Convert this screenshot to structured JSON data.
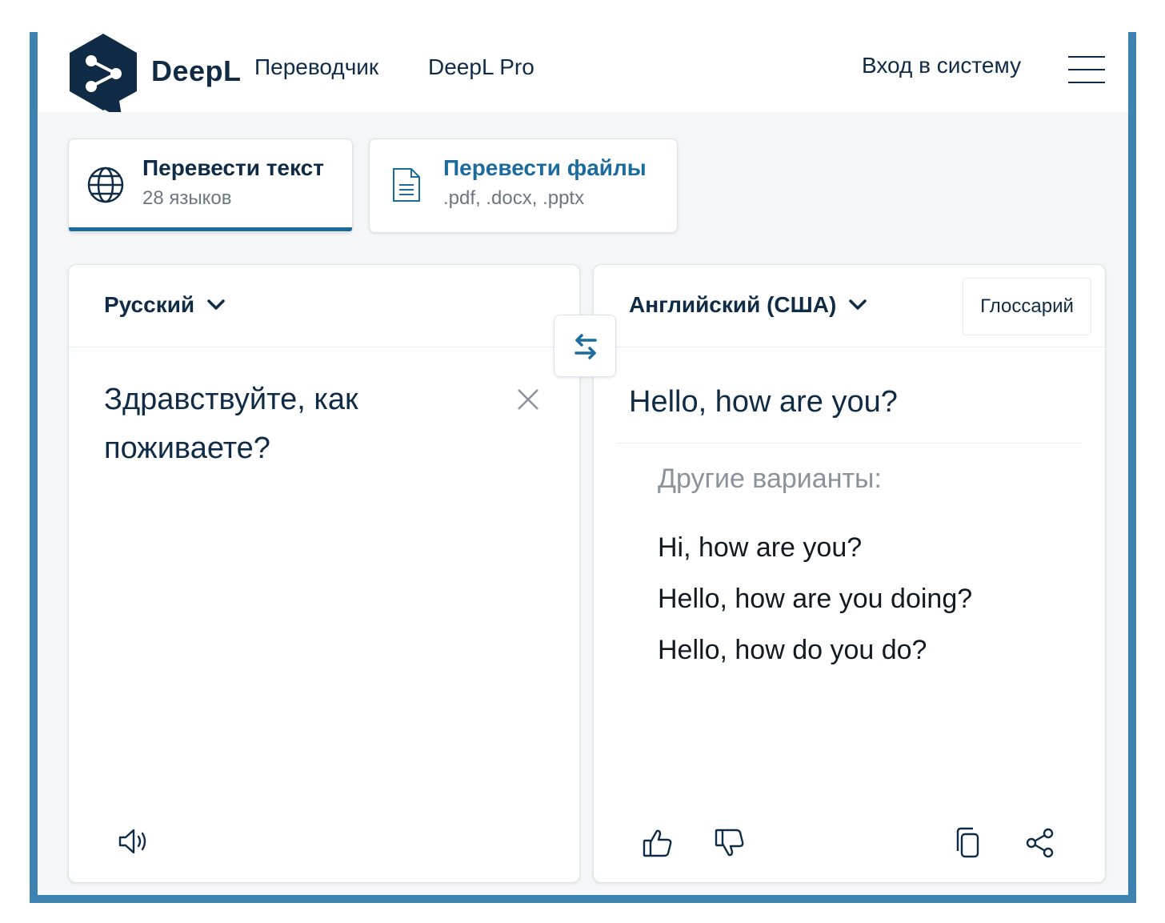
{
  "header": {
    "logo_word": "DeepL",
    "logo_sub": "Переводчик",
    "nav_pro": "DeepL Pro",
    "login": "Вход в систему"
  },
  "modes": {
    "text": {
      "title": "Перевести текст",
      "subtitle": "28 языков"
    },
    "files": {
      "title": "Перевести файлы",
      "subtitle": ".pdf, .docx, .pptx"
    }
  },
  "source": {
    "language": "Русский",
    "text": "Здравствуйте, как поживаете?"
  },
  "target": {
    "language": "Английский (США)",
    "glossary": "Глоссарий",
    "text": "Hello, how are you?",
    "alternatives_title": "Другие варианты:",
    "alternatives": [
      "Hi, how are you?",
      "Hello, how are you doing?",
      "Hello, how do you do?"
    ]
  },
  "colors": {
    "brand_navy": "#0f2b46",
    "accent_blue": "#1b6b9e",
    "frame_blue": "#3d82b1",
    "background": "#f5f6f7"
  },
  "icons": [
    "deepl-logo-icon",
    "menu-icon",
    "globe-icon",
    "document-icon",
    "chevron-down-icon",
    "swap-icon",
    "close-icon",
    "speaker-icon",
    "thumbs-up-icon",
    "thumbs-down-icon",
    "copy-icon",
    "share-icon"
  ]
}
